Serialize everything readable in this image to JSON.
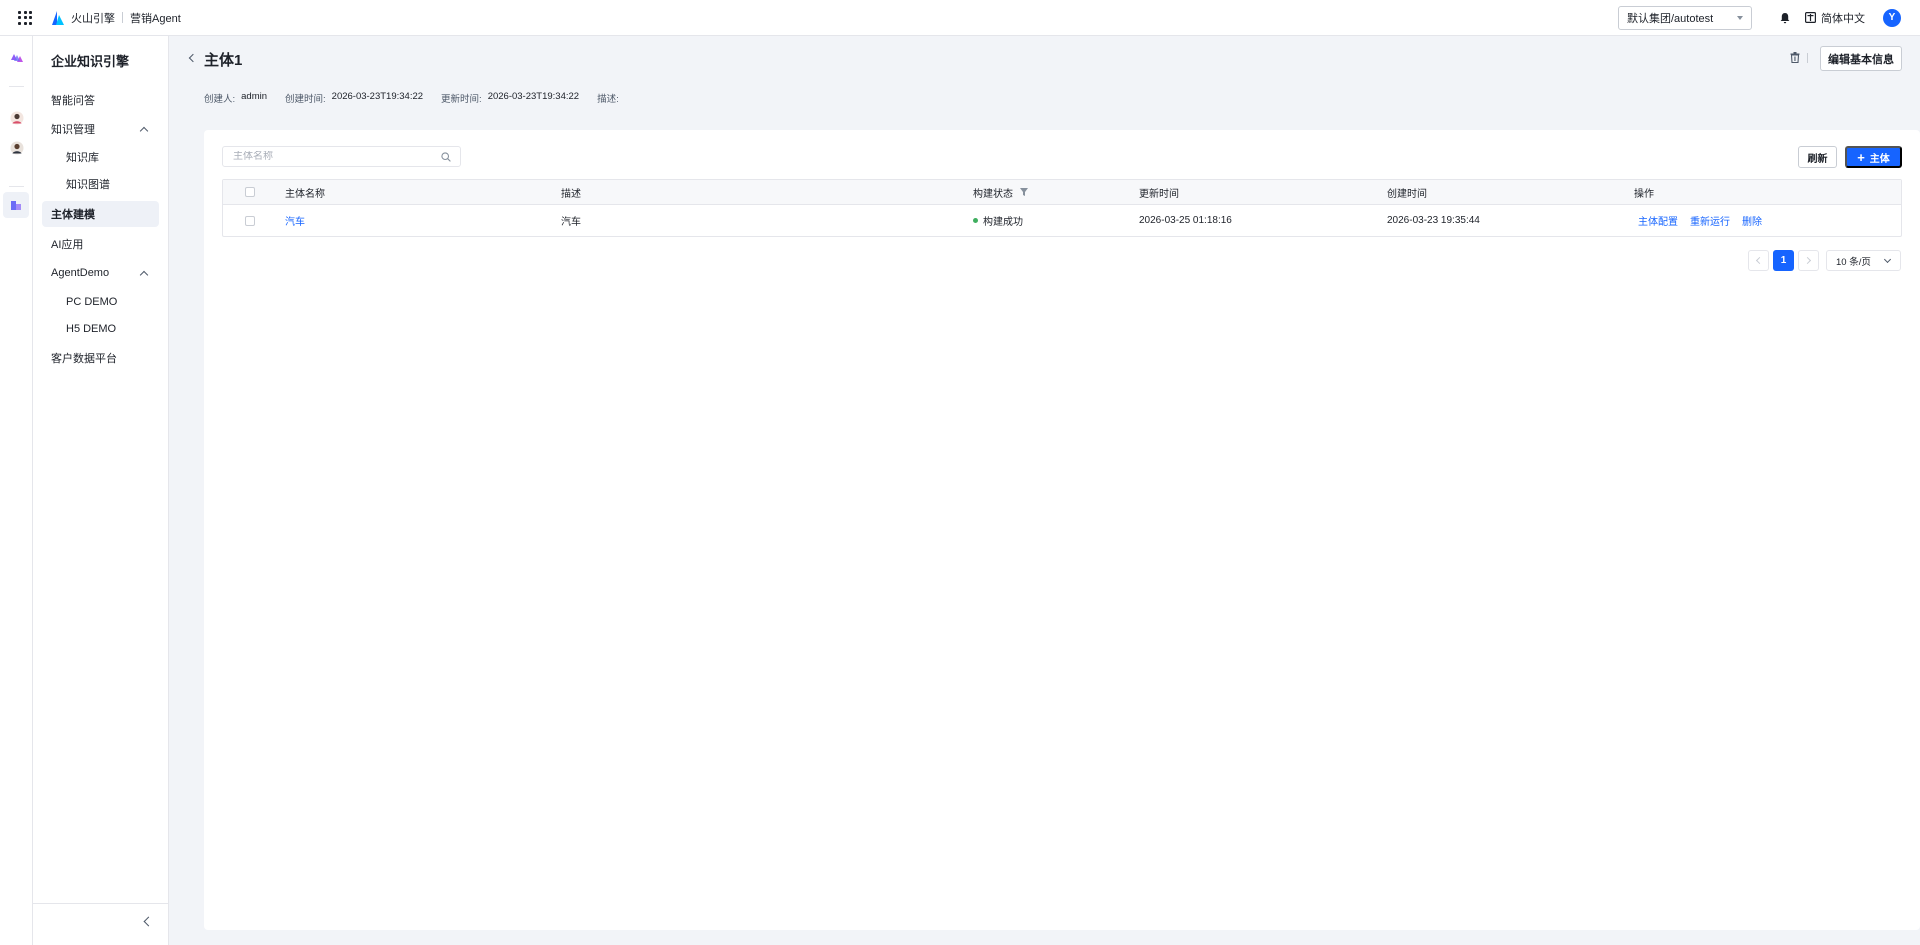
{
  "topbar": {
    "brand": "火山引擎",
    "product": "营销Agent",
    "org_select": "默认集团/autotest",
    "language": "简体中文",
    "avatar_letter": "Y"
  },
  "sidebar": {
    "title": "企业知识引擎",
    "items": [
      {
        "label": "智能问答"
      },
      {
        "label": "知识管理"
      },
      {
        "label": "知识库"
      },
      {
        "label": "知识图谱"
      },
      {
        "label": "主体建模"
      },
      {
        "label": "AI应用"
      },
      {
        "label": "AgentDemo"
      },
      {
        "label": "PC DEMO"
      },
      {
        "label": "H5 DEMO"
      },
      {
        "label": "客户数据平台"
      }
    ]
  },
  "page": {
    "title": "主体1",
    "edit_label": "编辑基本信息",
    "meta": {
      "creator_label": "创建人:",
      "creator": "admin",
      "created_label": "创建时间:",
      "created": "2026-03-23T19:34:22",
      "updated_label": "更新时间:",
      "updated": "2026-03-23T19:34:22",
      "desc_label": "描述:"
    }
  },
  "toolbar": {
    "search_placeholder": "主体名称",
    "refresh_label": "刷新",
    "add_label": "主体"
  },
  "table": {
    "columns": [
      "主体名称",
      "描述",
      "构建状态",
      "更新时间",
      "创建时间",
      "操作"
    ],
    "rows": [
      {
        "name": "汽车",
        "desc": "汽车",
        "status": "构建成功",
        "updated": "2026-03-25 01:18:16",
        "created": "2026-03-23 19:35:44",
        "ops": [
          "主体配置",
          "重新运行",
          "删除"
        ]
      }
    ]
  },
  "pagination": {
    "current": "1",
    "page_size": "10 条/页"
  },
  "colors": {
    "primary": "#1664ff",
    "success": "#3fae5f"
  }
}
